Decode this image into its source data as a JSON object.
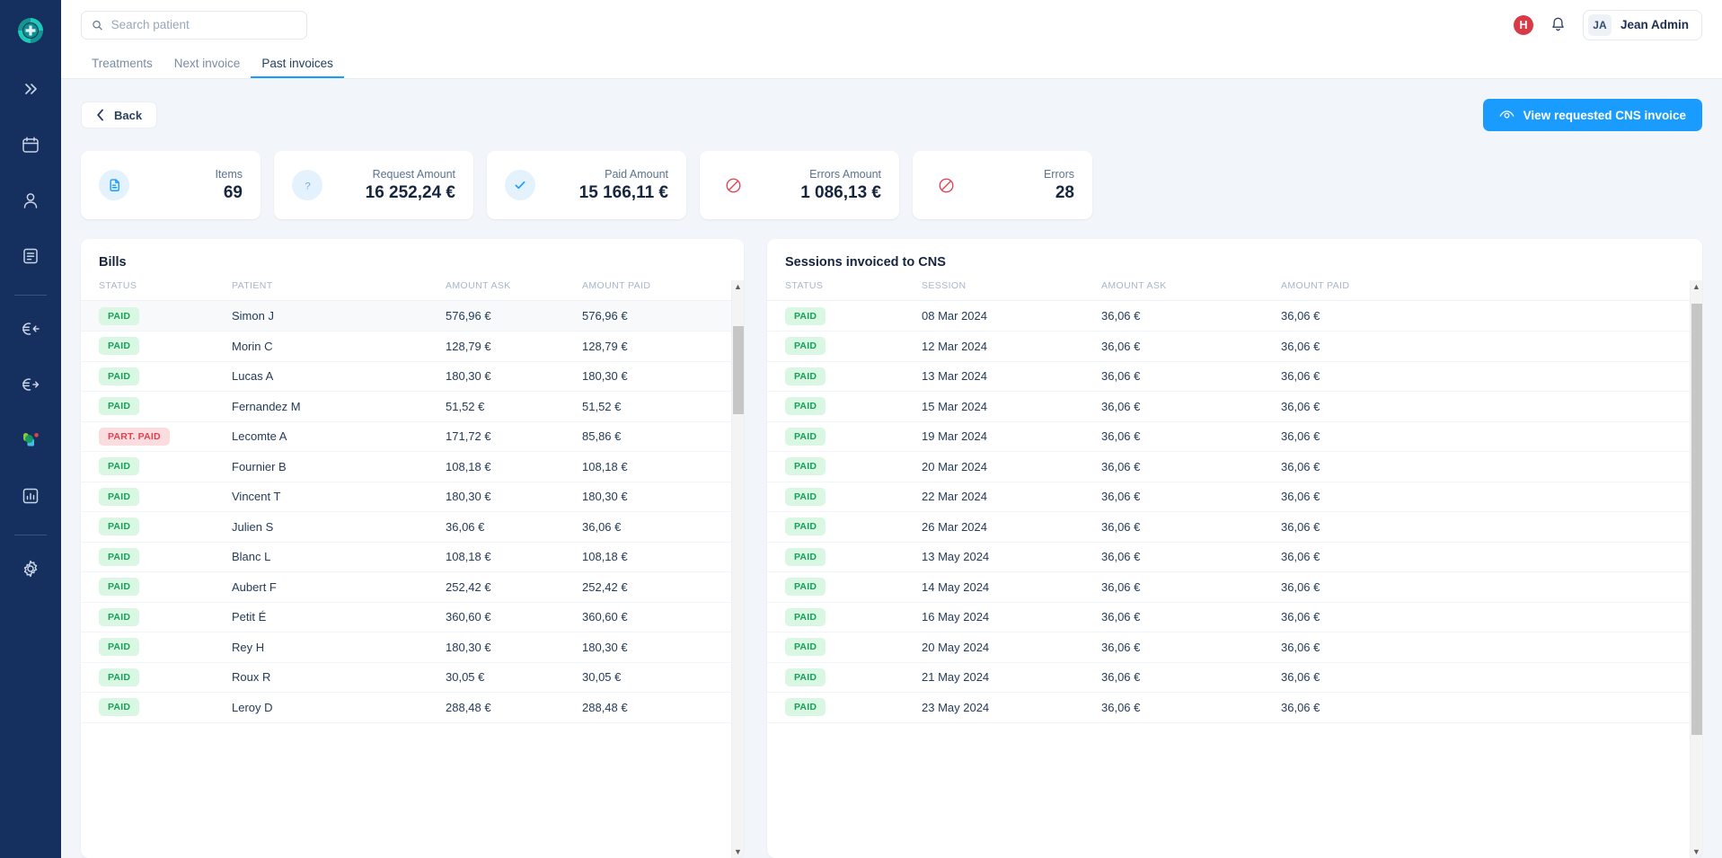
{
  "app": {
    "logo_icon": "medical-cross-circle-logo",
    "brand_color": "#17a39c"
  },
  "sidebar": {
    "items": [
      {
        "icon": "chevrons-right-icon",
        "name": "expand-sidebar"
      },
      {
        "icon": "calendar-icon",
        "name": "calendar"
      },
      {
        "icon": "user-icon",
        "name": "patients"
      },
      {
        "icon": "document-list-icon",
        "name": "documents"
      },
      {
        "icon": "euro-arrow-left-icon",
        "name": "incoming-payments"
      },
      {
        "icon": "euro-arrow-right-icon",
        "name": "outgoing-payments"
      },
      {
        "icon": "color-shapes-icon",
        "name": "apps"
      },
      {
        "icon": "bar-chart-icon",
        "name": "statistics"
      },
      {
        "icon": "gear-icon",
        "name": "settings"
      }
    ]
  },
  "topbar": {
    "search": {
      "placeholder": "Search patient",
      "value": "",
      "icon": "search-icon"
    },
    "help_badge": "H",
    "bell_icon": "bell-icon",
    "user": {
      "initials": "JA",
      "name": "Jean Admin"
    }
  },
  "tabs": [
    {
      "label": "Treatments",
      "active": false
    },
    {
      "label": "Next invoice",
      "active": false
    },
    {
      "label": "Past invoices",
      "active": true
    }
  ],
  "actions": {
    "back_label": "Back",
    "back_icon": "chevron-left-icon",
    "cns_label": "View requested CNS invoice",
    "cns_icon": "eye-icon",
    "cns_color": "#1a9cff"
  },
  "stats": [
    {
      "label": "Items",
      "value": "69",
      "icon": "documents-icon",
      "icon_style": "blue",
      "accent": "#1a9cff"
    },
    {
      "label": "Request Amount",
      "value": "16 252,24 €",
      "icon": "question-icon",
      "icon_style": "blue",
      "accent": "#1a9cff"
    },
    {
      "label": "Paid Amount",
      "value": "15 166,11 €",
      "icon": "check-icon",
      "icon_style": "blue",
      "accent": "#1a9cff"
    },
    {
      "label": "Errors Amount",
      "value": "1 086,13 €",
      "icon": "forbidden-icon",
      "icon_style": "plain",
      "accent": "#e0414f"
    },
    {
      "label": "Errors",
      "value": "28",
      "icon": "forbidden-icon",
      "icon_style": "plain",
      "accent": "#e0414f"
    }
  ],
  "bills": {
    "title": "Bills",
    "columns": [
      "STATUS",
      "PATIENT",
      "AMOUNT ASK",
      "AMOUNT PAID"
    ],
    "rows": [
      {
        "status": "PAID",
        "status_type": "paid",
        "patient": "Simon J",
        "ask": "576,96 €",
        "paid": "576,96 €",
        "highlight": true
      },
      {
        "status": "PAID",
        "status_type": "paid",
        "patient": "Morin C",
        "ask": "128,79 €",
        "paid": "128,79 €",
        "highlight": false
      },
      {
        "status": "PAID",
        "status_type": "paid",
        "patient": "Lucas A",
        "ask": "180,30 €",
        "paid": "180,30 €",
        "highlight": false
      },
      {
        "status": "PAID",
        "status_type": "paid",
        "patient": "Fernandez M",
        "ask": "51,52 €",
        "paid": "51,52 €",
        "highlight": false
      },
      {
        "status": "PART. PAID",
        "status_type": "part",
        "patient": "Lecomte A",
        "ask": "171,72 €",
        "paid": "85,86 €",
        "highlight": false
      },
      {
        "status": "PAID",
        "status_type": "paid",
        "patient": "Fournier B",
        "ask": "108,18 €",
        "paid": "108,18 €",
        "highlight": false
      },
      {
        "status": "PAID",
        "status_type": "paid",
        "patient": "Vincent T",
        "ask": "180,30 €",
        "paid": "180,30 €",
        "highlight": false
      },
      {
        "status": "PAID",
        "status_type": "paid",
        "patient": "Julien S",
        "ask": "36,06 €",
        "paid": "36,06 €",
        "highlight": false
      },
      {
        "status": "PAID",
        "status_type": "paid",
        "patient": "Blanc L",
        "ask": "108,18 €",
        "paid": "108,18 €",
        "highlight": false
      },
      {
        "status": "PAID",
        "status_type": "paid",
        "patient": "Aubert F",
        "ask": "252,42 €",
        "paid": "252,42 €",
        "highlight": false
      },
      {
        "status": "PAID",
        "status_type": "paid",
        "patient": "Petit É",
        "ask": "360,60 €",
        "paid": "360,60 €",
        "highlight": false
      },
      {
        "status": "PAID",
        "status_type": "paid",
        "patient": "Rey H",
        "ask": "180,30 €",
        "paid": "180,30 €",
        "highlight": false
      },
      {
        "status": "PAID",
        "status_type": "paid",
        "patient": "Roux R",
        "ask": "30,05 €",
        "paid": "30,05 €",
        "highlight": false
      },
      {
        "status": "PAID",
        "status_type": "paid",
        "patient": "Leroy D",
        "ask": "288,48 €",
        "paid": "288,48 €",
        "highlight": false
      }
    ],
    "scroll": {
      "thumb_top_pct": 6,
      "thumb_height_pct": 16
    }
  },
  "sessions": {
    "title": "Sessions invoiced to CNS",
    "columns": [
      "STATUS",
      "SESSION",
      "AMOUNT ASK",
      "AMOUNT PAID"
    ],
    "rows": [
      {
        "status": "PAID",
        "status_type": "paid",
        "session": "08 Mar 2024",
        "ask": "36,06 €",
        "paid": "36,06 €"
      },
      {
        "status": "PAID",
        "status_type": "paid",
        "session": "12 Mar 2024",
        "ask": "36,06 €",
        "paid": "36,06 €"
      },
      {
        "status": "PAID",
        "status_type": "paid",
        "session": "13 Mar 2024",
        "ask": "36,06 €",
        "paid": "36,06 €"
      },
      {
        "status": "PAID",
        "status_type": "paid",
        "session": "15 Mar 2024",
        "ask": "36,06 €",
        "paid": "36,06 €"
      },
      {
        "status": "PAID",
        "status_type": "paid",
        "session": "19 Mar 2024",
        "ask": "36,06 €",
        "paid": "36,06 €"
      },
      {
        "status": "PAID",
        "status_type": "paid",
        "session": "20 Mar 2024",
        "ask": "36,06 €",
        "paid": "36,06 €"
      },
      {
        "status": "PAID",
        "status_type": "paid",
        "session": "22 Mar 2024",
        "ask": "36,06 €",
        "paid": "36,06 €"
      },
      {
        "status": "PAID",
        "status_type": "paid",
        "session": "26 Mar 2024",
        "ask": "36,06 €",
        "paid": "36,06 €"
      },
      {
        "status": "PAID",
        "status_type": "paid",
        "session": "13 May 2024",
        "ask": "36,06 €",
        "paid": "36,06 €"
      },
      {
        "status": "PAID",
        "status_type": "paid",
        "session": "14 May 2024",
        "ask": "36,06 €",
        "paid": "36,06 €"
      },
      {
        "status": "PAID",
        "status_type": "paid",
        "session": "16 May 2024",
        "ask": "36,06 €",
        "paid": "36,06 €"
      },
      {
        "status": "PAID",
        "status_type": "paid",
        "session": "20 May 2024",
        "ask": "36,06 €",
        "paid": "36,06 €"
      },
      {
        "status": "PAID",
        "status_type": "paid",
        "session": "21 May 2024",
        "ask": "36,06 €",
        "paid": "36,06 €"
      },
      {
        "status": "PAID",
        "status_type": "paid",
        "session": "23 May 2024",
        "ask": "36,06 €",
        "paid": "36,06 €"
      }
    ],
    "scroll": {
      "thumb_top_pct": 2,
      "thumb_height_pct": 78
    }
  }
}
